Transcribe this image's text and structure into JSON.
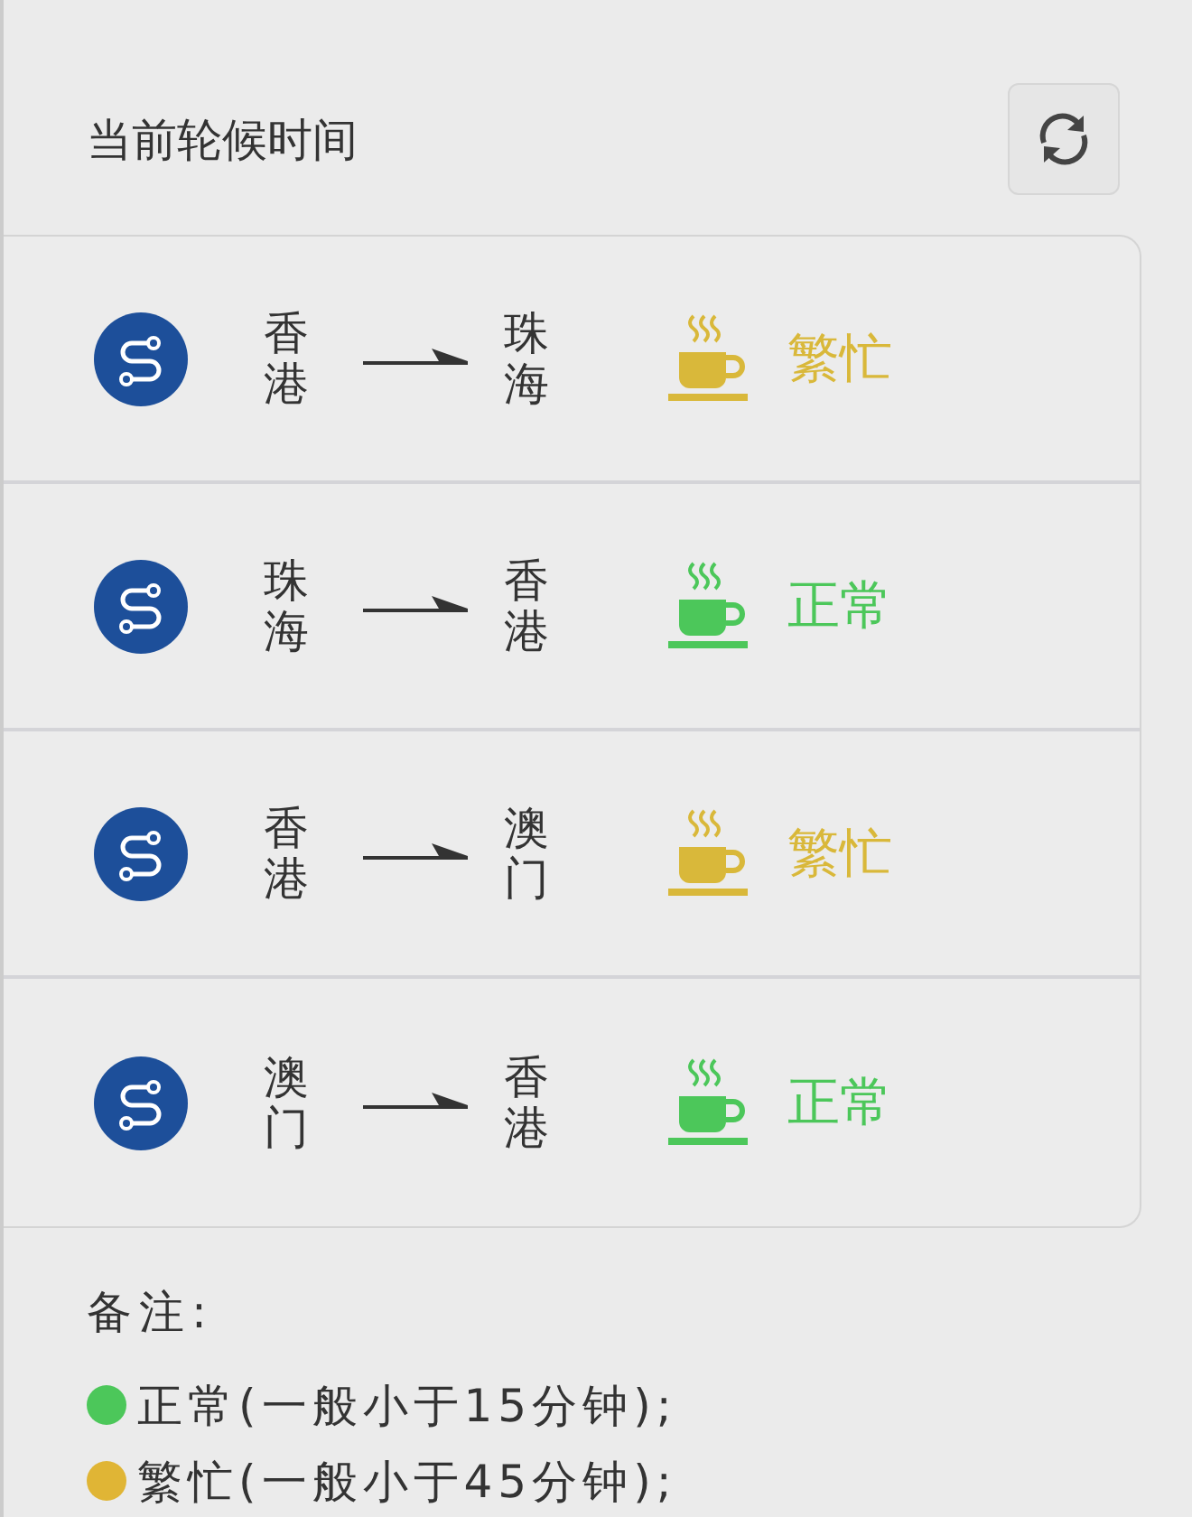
{
  "header": {
    "title": "当前轮候时间"
  },
  "routes": [
    {
      "from": "香港",
      "to": "珠海",
      "status": "繁忙",
      "color": "#d9b83a"
    },
    {
      "from": "珠海",
      "to": "香港",
      "status": "正常",
      "color": "#4cc75a"
    },
    {
      "from": "香港",
      "to": "澳门",
      "status": "繁忙",
      "color": "#d9b83a"
    },
    {
      "from": "澳门",
      "to": "香港",
      "status": "正常",
      "color": "#4cc75a"
    }
  ],
  "notes": {
    "title": "备注:",
    "items": [
      {
        "text": "正常(一般小于15分钟);",
        "color": "#4cc75a"
      },
      {
        "text": "繁忙(一般小于45分钟);",
        "color": "#e0b535"
      }
    ]
  }
}
